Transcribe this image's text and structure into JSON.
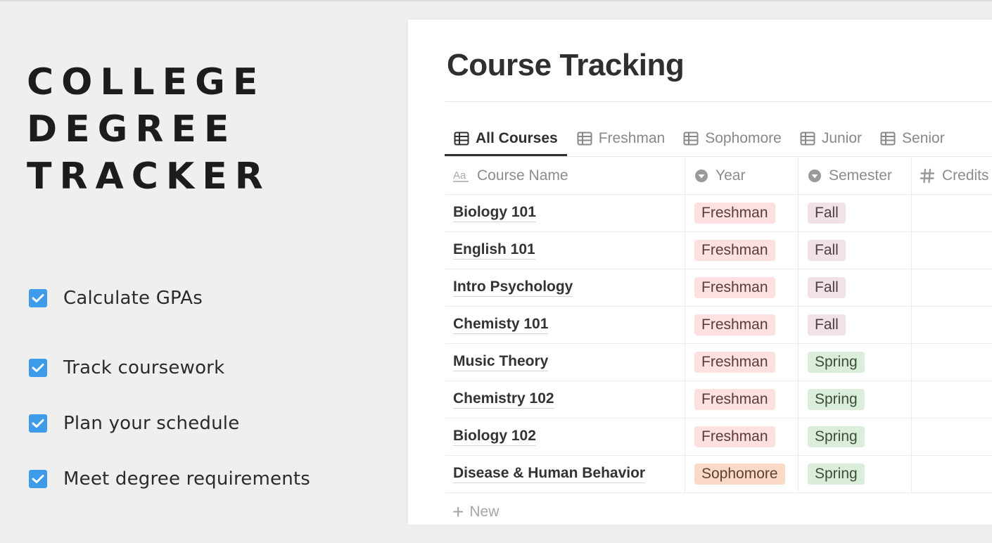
{
  "promo": {
    "title_lines": [
      "COLLEGE",
      "DEGREE",
      "TRACKER"
    ],
    "features": [
      {
        "label": "Calculate GPAs",
        "checked": true
      },
      {
        "label": "Track coursework",
        "checked": true
      },
      {
        "label": "Plan your schedule",
        "checked": true
      },
      {
        "label": "Meet degree requirements",
        "checked": true
      }
    ],
    "checkbox_color": "#3d9be9"
  },
  "database": {
    "title": "Course Tracking",
    "tabs": [
      {
        "label": "All Courses",
        "icon": "table-icon",
        "active": true
      },
      {
        "label": "Freshman",
        "icon": "table-icon",
        "active": false
      },
      {
        "label": "Sophomore",
        "icon": "table-icon",
        "active": false
      },
      {
        "label": "Junior",
        "icon": "table-icon",
        "active": false
      },
      {
        "label": "Senior",
        "icon": "table-icon",
        "active": false
      }
    ],
    "columns": [
      {
        "label": "Course Name",
        "icon": "text-property-icon"
      },
      {
        "label": "Year",
        "icon": "select-property-icon"
      },
      {
        "label": "Semester",
        "icon": "select-property-icon"
      },
      {
        "label": "Credits",
        "icon": "number-property-icon"
      }
    ],
    "rows": [
      {
        "name": "Biology 101",
        "year": "Freshman",
        "semester": "Fall",
        "credits": ""
      },
      {
        "name": "English 101",
        "year": "Freshman",
        "semester": "Fall",
        "credits": ""
      },
      {
        "name": "Intro Psychology",
        "year": "Freshman",
        "semester": "Fall",
        "credits": ""
      },
      {
        "name": "Chemisty 101",
        "year": "Freshman",
        "semester": "Fall",
        "credits": ""
      },
      {
        "name": "Music Theory",
        "year": "Freshman",
        "semester": "Spring",
        "credits": ""
      },
      {
        "name": "Chemistry 102",
        "year": "Freshman",
        "semester": "Spring",
        "credits": ""
      },
      {
        "name": "Biology 102",
        "year": "Freshman",
        "semester": "Spring",
        "credits": ""
      },
      {
        "name": "Disease & Human Behavior",
        "year": "Sophomore",
        "semester": "Spring",
        "credits": ""
      }
    ],
    "new_label": "New",
    "tag_colors": {
      "Freshman": "#fde0df",
      "Sophomore": "#fadac6",
      "Fall": "#f3e1e8",
      "Spring": "#dbeedc"
    }
  }
}
